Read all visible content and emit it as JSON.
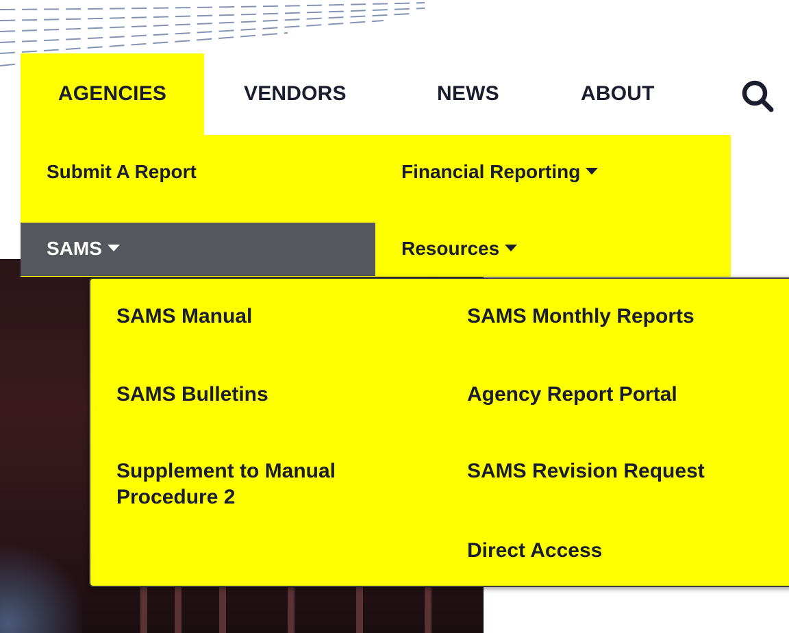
{
  "nav": {
    "agencies": "AGENCIES",
    "vendors": "VENDORS",
    "news": "NEWS",
    "about": "ABOUT"
  },
  "agencies_menu": {
    "submit_report": "Submit A Report",
    "financial_reporting": "Financial Reporting",
    "sams": "SAMS",
    "resources": "Resources"
  },
  "sams_menu": {
    "left": [
      "SAMS Manual",
      "SAMS Bulletins",
      "Supplement to Manual Procedure 2"
    ],
    "right": [
      "SAMS Monthly Reports",
      "Agency Report Portal",
      "SAMS Revision Request",
      "Direct Access"
    ]
  },
  "colors": {
    "accent": "#ffff00",
    "active_item": "#56575c",
    "text": "#1a1d2e"
  },
  "icons": {
    "search": "search-icon",
    "caret": "caret-down-icon"
  }
}
